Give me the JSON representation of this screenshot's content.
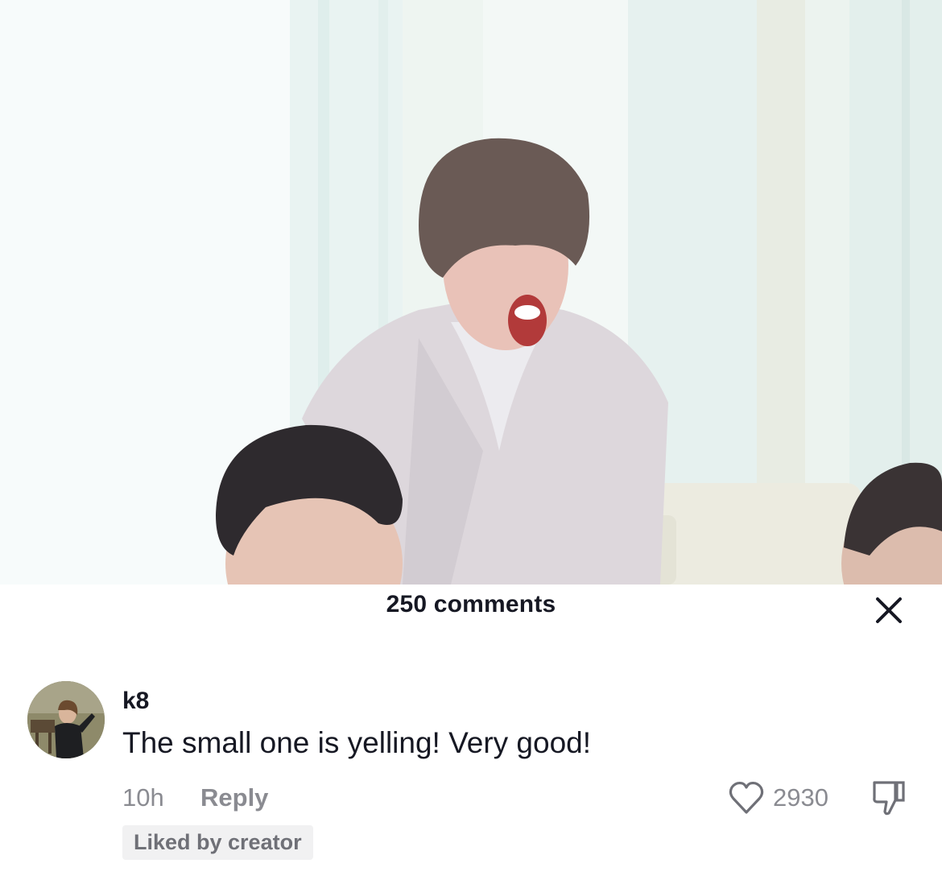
{
  "video": {
    "scene_icon": "video-frame"
  },
  "comments_sheet": {
    "title": "250 comments",
    "close_icon": "close-icon"
  },
  "comment": {
    "username": "k8",
    "text": "The small one is yelling! Very good!",
    "time": "10h",
    "reply_label": "Reply",
    "like_count": "2930",
    "liked_badge": "Liked by creator",
    "like_icon": "heart-outline-icon",
    "dislike_icon": "thumbs-down-icon"
  },
  "colors": {
    "primary_text": "#161823",
    "secondary_text": "#8a8b91",
    "badge_bg": "#f1f1f2"
  }
}
